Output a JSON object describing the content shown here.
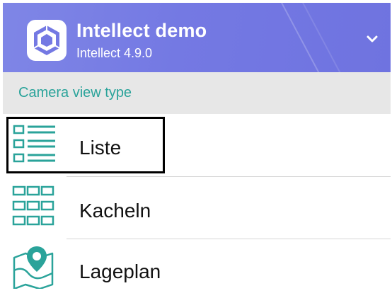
{
  "header": {
    "title": "Intellect demo",
    "subtitle": "Intellect 4.9.0",
    "logo_icon": "intellect-logo-icon",
    "chevron_icon": "chevron-down-icon"
  },
  "section": {
    "title": "Camera view type"
  },
  "view_types": [
    {
      "label": "Liste",
      "icon": "list-view-icon",
      "selected": true
    },
    {
      "label": "Kacheln",
      "icon": "grid-view-icon",
      "selected": false
    },
    {
      "label": "Lageplan",
      "icon": "map-view-icon",
      "selected": false
    }
  ],
  "colors": {
    "header_bg": "#7479e3",
    "accent_teal": "#2aa39a",
    "section_bg": "#e7e7e7"
  }
}
